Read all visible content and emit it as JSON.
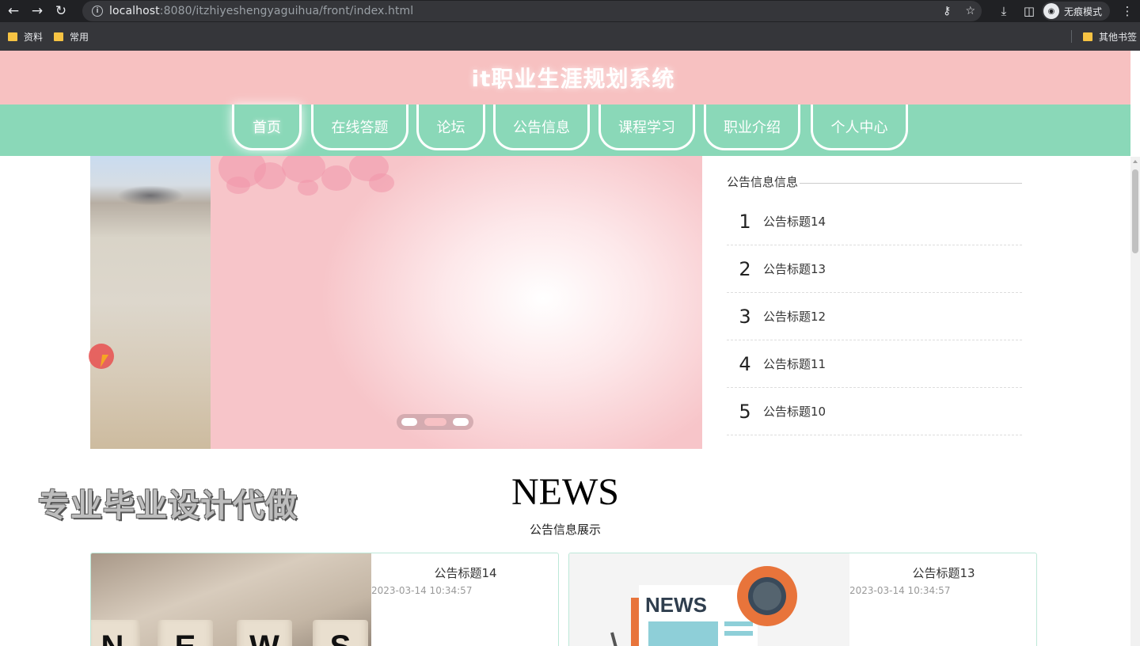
{
  "browser": {
    "url_host": "localhost",
    "url_rest": ":8080/itzhiyeshengyaguihua/front/index.html",
    "incognito_label": "无痕模式",
    "bookmarks": [
      "资料",
      "常用"
    ],
    "other_bookmarks": "其他书签"
  },
  "site": {
    "title": "it职业生涯规划系统"
  },
  "nav": {
    "items": [
      "首页",
      "在线答题",
      "论坛",
      "公告信息",
      "课程学习",
      "职业介绍",
      "个人中心"
    ]
  },
  "notice": {
    "heading": "公告信息信息",
    "items": [
      {
        "num": "1",
        "title": "公告标题14"
      },
      {
        "num": "2",
        "title": "公告标题13"
      },
      {
        "num": "3",
        "title": "公告标题12"
      },
      {
        "num": "4",
        "title": "公告标题11"
      },
      {
        "num": "5",
        "title": "公告标题10"
      }
    ]
  },
  "news": {
    "title": "NEWS",
    "subtitle": "公告信息展示",
    "cards": [
      {
        "title": "公告标题14",
        "time": "2023-03-14 10:34:57",
        "image_text": "NEWS"
      },
      {
        "title": "公告标题13",
        "time": "2023-03-14 10:34:57",
        "image_text": "NEWS"
      }
    ]
  },
  "watermark": "专业毕业设计代做",
  "colors": {
    "header_bg": "#f7c1c1",
    "nav_bg": "#8ad8b8",
    "chrome_bg": "#202124"
  }
}
